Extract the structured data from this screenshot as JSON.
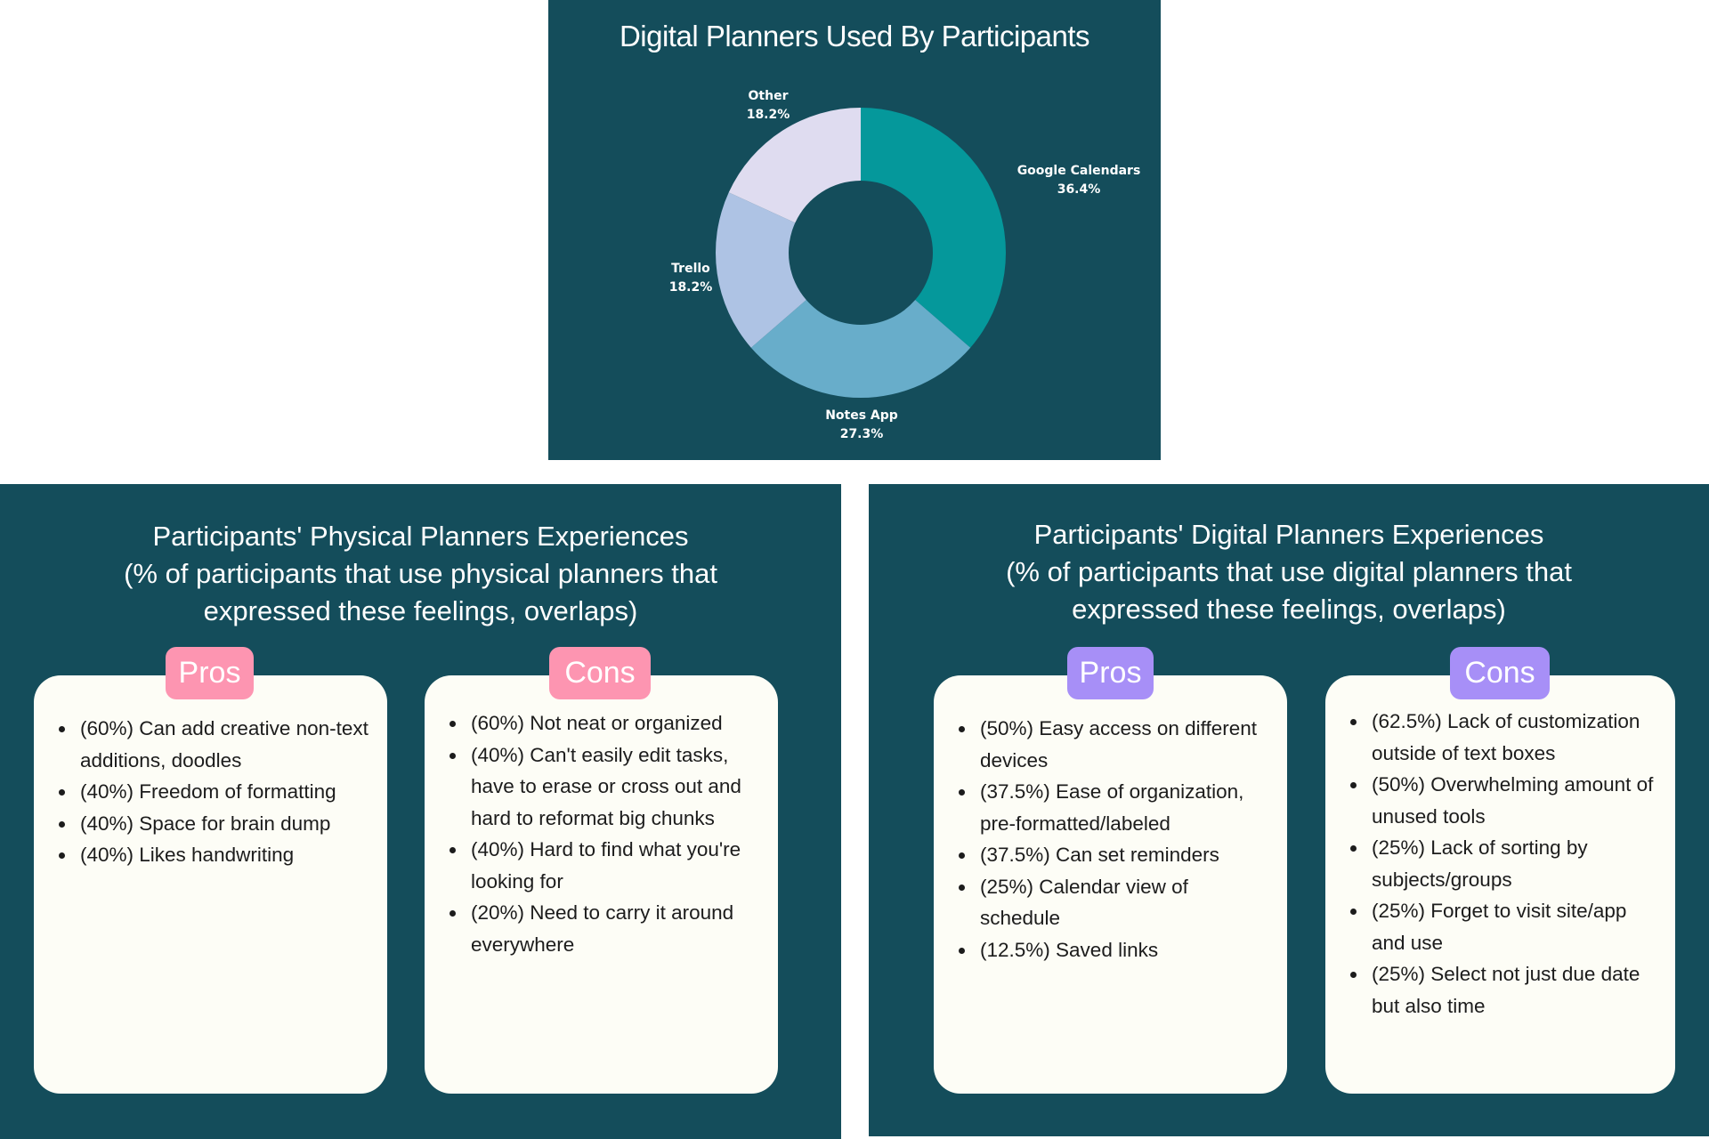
{
  "chart_data": {
    "type": "pie",
    "variant": "donut",
    "title": "Digital Planners Used By Participants",
    "slices": [
      {
        "label": "Google Calendars",
        "value": 36.4,
        "display": "36.4%",
        "color": "#05989b"
      },
      {
        "label": "Notes App",
        "value": 27.3,
        "display": "27.3%",
        "color": "#68adca"
      },
      {
        "label": "Trello",
        "value": 18.2,
        "display": "18.2%",
        "color": "#aec3e4"
      },
      {
        "label": "Other",
        "value": 18.2,
        "display": "18.2%",
        "color": "#dfdcf0"
      }
    ]
  },
  "physical": {
    "title_lines": [
      "Participants' Physical Planners Experiences",
      "(% of participants that use physical planners that",
      "expressed these feelings, overlaps)"
    ],
    "pros_label": "Pros",
    "cons_label": "Cons",
    "pros": [
      "(60%) Can add creative non-text additions, doodles",
      "(40%) Freedom of formatting",
      "(40%) Space for brain dump",
      "(40%) Likes handwriting"
    ],
    "cons": [
      "(60%) Not neat or organized",
      "(40%) Can't easily edit tasks, have to erase or cross out and hard to reformat big chunks",
      "(40%) Hard to find what you're looking for",
      "(20%) Need to carry it around everywhere"
    ]
  },
  "digital": {
    "title_lines": [
      "Participants' Digital Planners Experiences",
      "(% of participants that use digital planners that",
      "expressed these feelings, overlaps)"
    ],
    "pros_label": "Pros",
    "cons_label": "Cons",
    "pros": [
      "(50%) Easy access on different devices",
      "(37.5%) Ease of organization, pre-formatted/labeled",
      "(37.5%) Can set reminders",
      "(25%) Calendar view of schedule",
      "(12.5%) Saved links"
    ],
    "cons": [
      "(62.5%) Lack of customization outside of text boxes",
      "(50%) Overwhelming amount of unused tools",
      "(25%) Lack of sorting by subjects/groups",
      "(25%) Forget to visit site/app and use",
      "(25%) Select not just due date but also time"
    ]
  },
  "colors": {
    "panel": "#144d5b",
    "card": "#fdfdf6",
    "pink_badge": "#fd95b1",
    "purple_badge": "#a78ff7"
  }
}
